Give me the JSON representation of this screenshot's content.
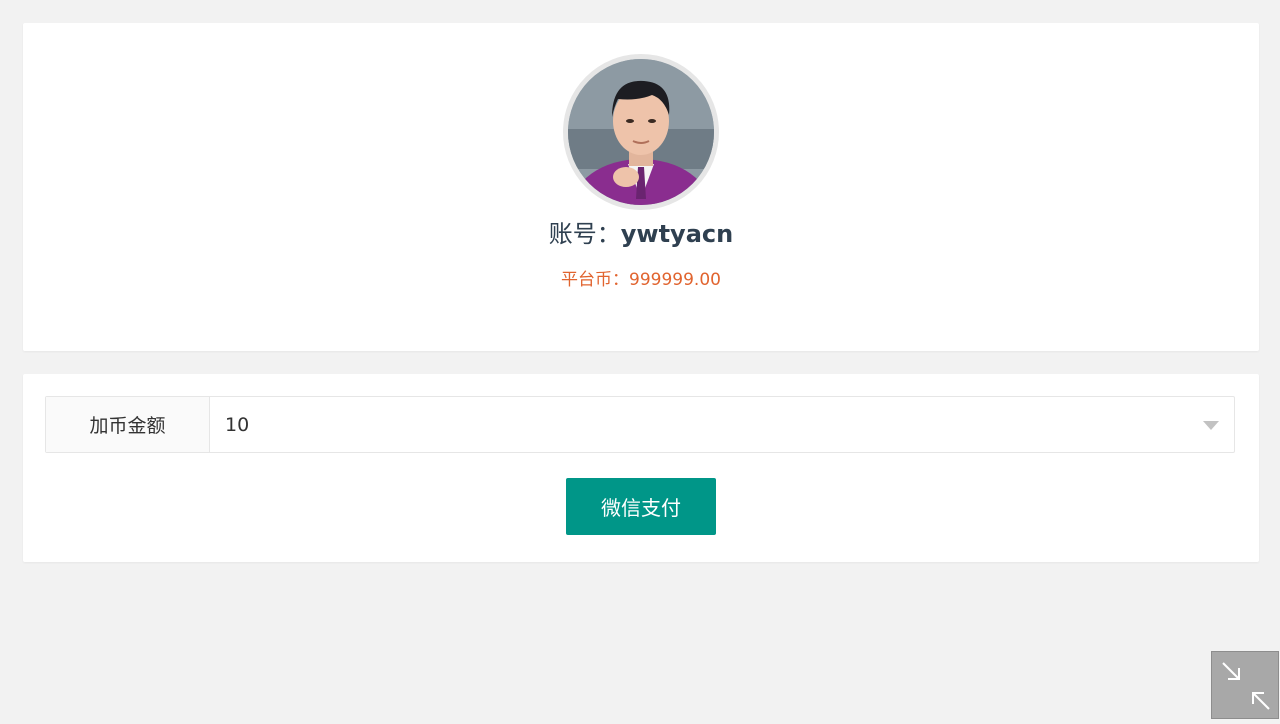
{
  "profile": {
    "account_label": "账号：",
    "username": "ywtyacn",
    "balance_label": "平台币：",
    "balance_value": "999999.00"
  },
  "recharge": {
    "amount_label": "加币金额",
    "amount_value": "10",
    "pay_button_label": "微信支付"
  },
  "icons": {
    "dropdown": "chevron-down-icon",
    "corner": "collapse-arrows-icon"
  },
  "colors": {
    "accent": "#009688",
    "balance": "#e1642f",
    "background": "#f2f2f2"
  }
}
